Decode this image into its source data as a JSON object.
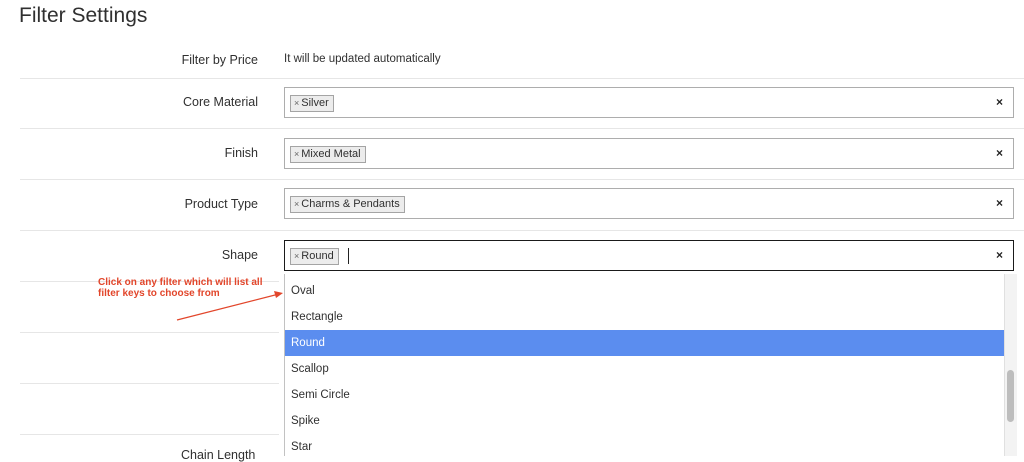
{
  "page_title": "Filter Settings",
  "fields": {
    "price": {
      "label": "Filter by Price",
      "value": "It will be updated automatically"
    },
    "core_material": {
      "label": "Core Material",
      "chip": "Silver",
      "clear": "×"
    },
    "finish": {
      "label": "Finish",
      "chip": "Mixed Metal",
      "clear": "×"
    },
    "product_type": {
      "label": "Product Type",
      "chip": "Charms & Pendants",
      "clear": "×"
    },
    "shape": {
      "label": "Shape",
      "chip": "Round",
      "clear": "×"
    }
  },
  "chip_remove": "×",
  "dropdown": {
    "options": [
      "Oval",
      "Rectangle",
      "Round",
      "Scallop",
      "Semi Circle",
      "Spike",
      "Star"
    ],
    "selected": "Round"
  },
  "annotation": "Click on any filter which will list all filter keys to choose from",
  "annotation_color": "#e2462b",
  "highlight_color": "#5b8def",
  "partial_label": "Chain Length"
}
